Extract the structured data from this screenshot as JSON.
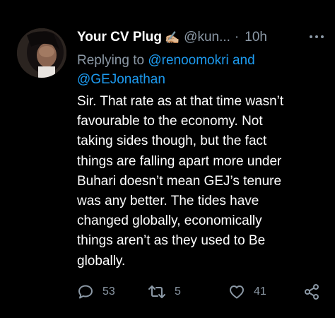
{
  "tweet": {
    "display_name": "Your CV Plug",
    "name_emoji": "✍🏼",
    "handle": "@kun...",
    "separator": "·",
    "time": "10h",
    "replying_prefix": "Replying to ",
    "replying_mention_1": "@renoomokri",
    "replying_and": " and",
    "replying_mention_2": "@GEJonathan",
    "text": "Sir. That rate as at that time wasn’t\nfavourable to the economy. Not\ntaking sides though, but the fact\nthings are falling apart more under\nBuhari doesn’t mean GEJ’s tenure\nwas any better. The tides have\nchanged globally, economically\nthings aren’t as they used to Be\nglobally.",
    "reply_count": "53",
    "retweet_count": "5",
    "like_count": "41"
  },
  "colors": {
    "background": "#000000",
    "primary_text": "#ffffff",
    "secondary_text": "#8b98a5",
    "link": "#1d9bf0"
  },
  "icons": {
    "more": "more-horizontal-icon",
    "reply": "comment-icon",
    "retweet": "retweet-icon",
    "like": "heart-icon",
    "share": "share-icon"
  }
}
